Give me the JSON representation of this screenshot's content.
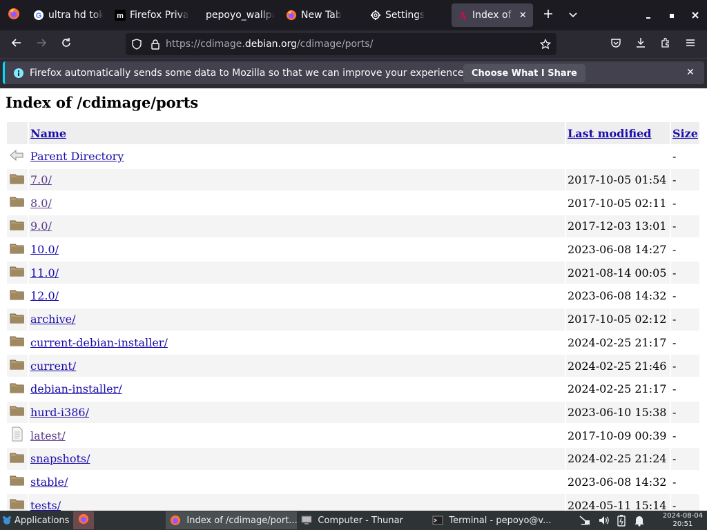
{
  "browser": {
    "tabs": [
      {
        "label": "ultra hd toky",
        "icon": "google-g-icon",
        "active": false
      },
      {
        "label": "Firefox Priva",
        "icon": "medium-m-icon",
        "active": false
      },
      {
        "label": "pepoyo_wallpa",
        "icon": "none",
        "active": false
      },
      {
        "label": "New Tab",
        "icon": "firefox-icon",
        "active": false
      },
      {
        "label": "Settings",
        "icon": "gear-icon",
        "active": false
      },
      {
        "label": "Index of /c",
        "icon": "debian-a-icon",
        "active": true
      }
    ],
    "url": {
      "prefix": "https://cdimage.",
      "host": "debian.org",
      "path": "/cdimage/ports/"
    },
    "notification": {
      "text": "Firefox automatically sends some data to Mozilla so that we can improve your experience.",
      "button": "Choose What I Share"
    }
  },
  "page": {
    "title": "Index of /cdimage/ports",
    "columns": {
      "name": "Name",
      "modified": "Last modified",
      "size": "Size"
    },
    "parent": {
      "name": "Parent Directory",
      "size": "-"
    },
    "rows": [
      {
        "name": "7.0/",
        "modified": "2017-10-05 01:54",
        "size": "-",
        "icon": "folder-icon",
        "visited": true
      },
      {
        "name": "8.0/",
        "modified": "2017-10-05 02:11",
        "size": "-",
        "icon": "folder-icon",
        "visited": true
      },
      {
        "name": "9.0/",
        "modified": "2017-12-03 13:01",
        "size": "-",
        "icon": "folder-icon",
        "visited": true
      },
      {
        "name": "10.0/",
        "modified": "2023-06-08 14:27",
        "size": "-",
        "icon": "folder-icon",
        "visited": false
      },
      {
        "name": "11.0/",
        "modified": "2021-08-14 00:05",
        "size": "-",
        "icon": "folder-icon",
        "visited": false
      },
      {
        "name": "12.0/",
        "modified": "2023-06-08 14:32",
        "size": "-",
        "icon": "folder-icon",
        "visited": false
      },
      {
        "name": "archive/",
        "modified": "2017-10-05 02:12",
        "size": "-",
        "icon": "folder-icon",
        "visited": false
      },
      {
        "name": "current-debian-installer/",
        "modified": "2024-02-25 21:17",
        "size": "-",
        "icon": "folder-icon",
        "visited": false
      },
      {
        "name": "current/",
        "modified": "2024-02-25 21:46",
        "size": "-",
        "icon": "folder-icon",
        "visited": false
      },
      {
        "name": "debian-installer/",
        "modified": "2024-02-25 21:17",
        "size": "-",
        "icon": "folder-icon",
        "visited": false
      },
      {
        "name": "hurd-i386/",
        "modified": "2023-06-10 15:38",
        "size": "-",
        "icon": "folder-icon",
        "visited": false
      },
      {
        "name": "latest/",
        "modified": "2017-10-09 00:39",
        "size": "-",
        "icon": "file-icon",
        "visited": true
      },
      {
        "name": "snapshots/",
        "modified": "2024-02-25 21:24",
        "size": "-",
        "icon": "folder-icon",
        "visited": false
      },
      {
        "name": "stable/",
        "modified": "2023-06-08 14:32",
        "size": "-",
        "icon": "folder-icon",
        "visited": false
      },
      {
        "name": "tests/",
        "modified": "2024-05-11 15:14",
        "size": "-",
        "icon": "folder-icon",
        "visited": false
      }
    ]
  },
  "taskbar": {
    "apps_label": "Applications",
    "windows": [
      {
        "label": "Index of /cdimage/port...",
        "icon": "firefox-icon",
        "active": true
      },
      {
        "label": "Computer - Thunar",
        "icon": "monitor-icon",
        "active": false
      },
      {
        "label": "Terminal - pepoyo@v...",
        "icon": "terminal-icon",
        "active": false
      }
    ],
    "clock_date": "2024-08-04",
    "clock_time": "20:51"
  },
  "colors": {
    "tabbar_bg": "#1c1b22",
    "toolbar_bg": "#2b2a33",
    "link": "#1a0dab",
    "link_visited": "#5a3c8c",
    "info_accent": "#00ddff"
  }
}
